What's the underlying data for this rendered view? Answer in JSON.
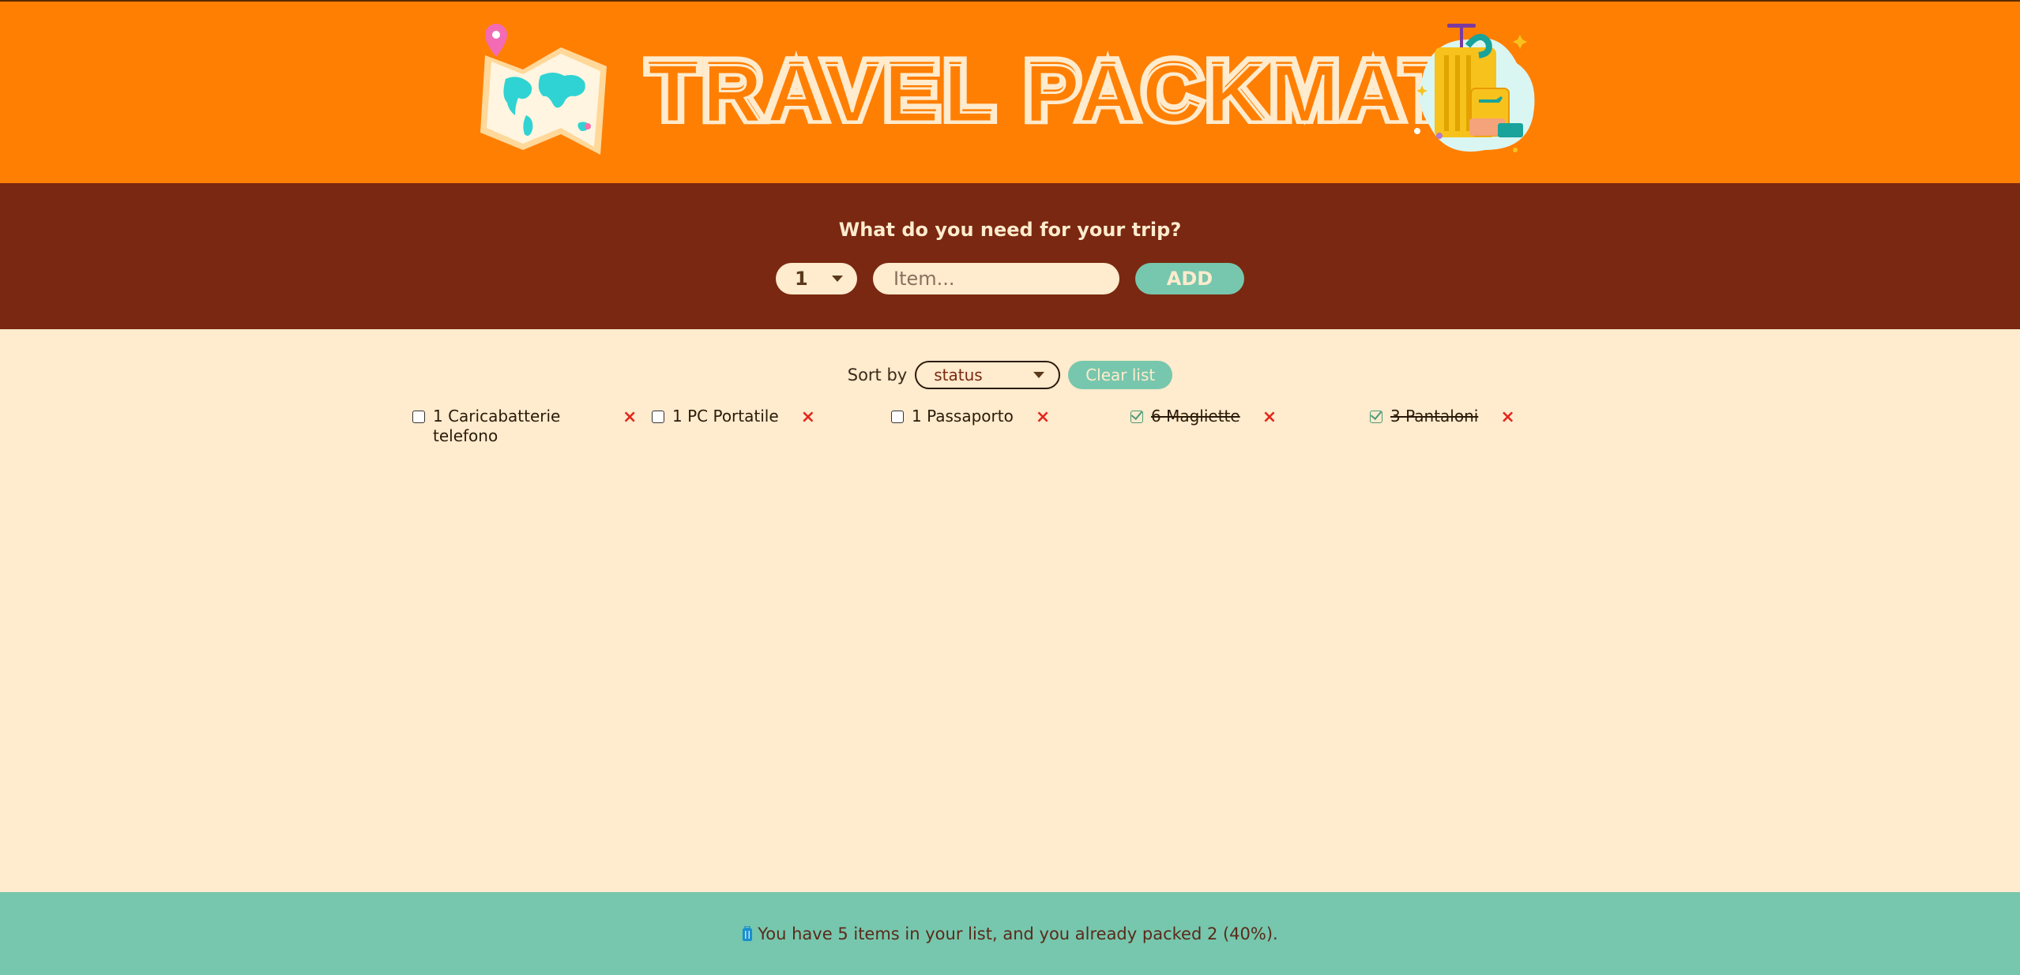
{
  "header": {
    "title": "TRAVEL PACKMATE"
  },
  "form": {
    "question": "What do you need for your trip?",
    "quantity_value": "1",
    "item_placeholder": "Item...",
    "add_label": "ADD"
  },
  "list_controls": {
    "sort_label": "Sort by",
    "sort_value": "status",
    "clear_label": "Clear list"
  },
  "items": [
    {
      "label": "1 Caricabatterie telefono",
      "packed": false
    },
    {
      "label": "1 PC Portatile",
      "packed": false
    },
    {
      "label": "1 Passaporto",
      "packed": false
    },
    {
      "label": "6 Magliette",
      "packed": true
    },
    {
      "label": "3 Pantaloni",
      "packed": true
    }
  ],
  "delete_symbol": "×",
  "footer": {
    "stats_text": "You have 5 items in your list, and you already packed 2 (40%)."
  },
  "colors": {
    "header_bg": "#ff7f03",
    "form_bg": "#7a2811",
    "list_bg": "#ffebcd",
    "accent": "#76c7ad",
    "delete": "#e2281e"
  }
}
